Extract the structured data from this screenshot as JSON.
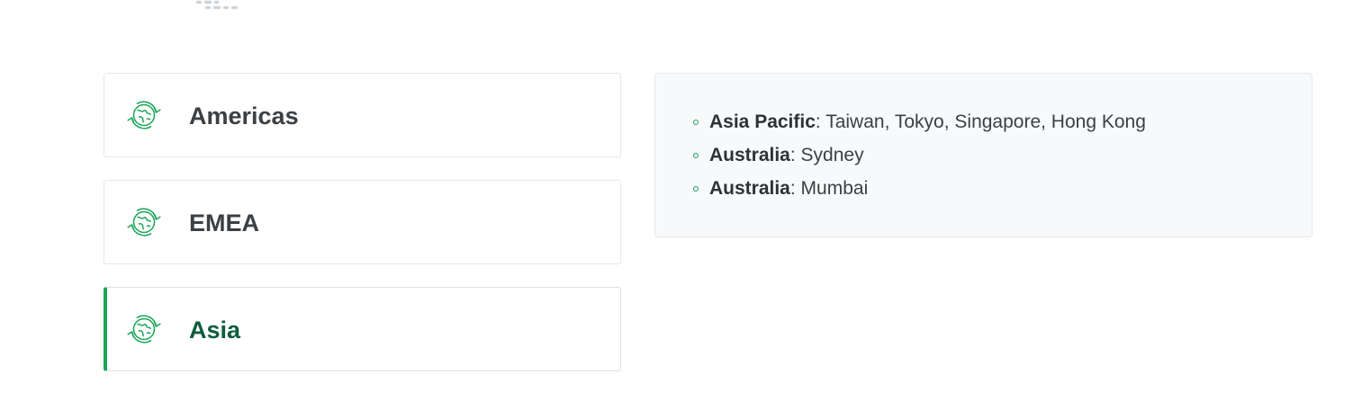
{
  "tabs": [
    {
      "label": "Americas",
      "icon": "globe-refresh-icon",
      "active": false
    },
    {
      "label": "EMEA",
      "icon": "globe-refresh-icon",
      "active": false
    },
    {
      "label": "Asia",
      "icon": "globe-refresh-icon",
      "active": true
    }
  ],
  "details": {
    "items": [
      {
        "region": "Asia Pacific",
        "separator": ":",
        "locations": " Taiwan, Tokyo, Singapore, Hong Kong"
      },
      {
        "region": "Australia",
        "separator": ":",
        "locations": " Sydney"
      },
      {
        "region": "Australia",
        "separator": ":",
        "locations": " Mumbai"
      }
    ]
  },
  "colors": {
    "accent": "#1aa557",
    "active_text": "#0f5c3e",
    "text": "#3d4043",
    "panel_bg": "#f8f9fa",
    "border": "#e5e7ea"
  }
}
